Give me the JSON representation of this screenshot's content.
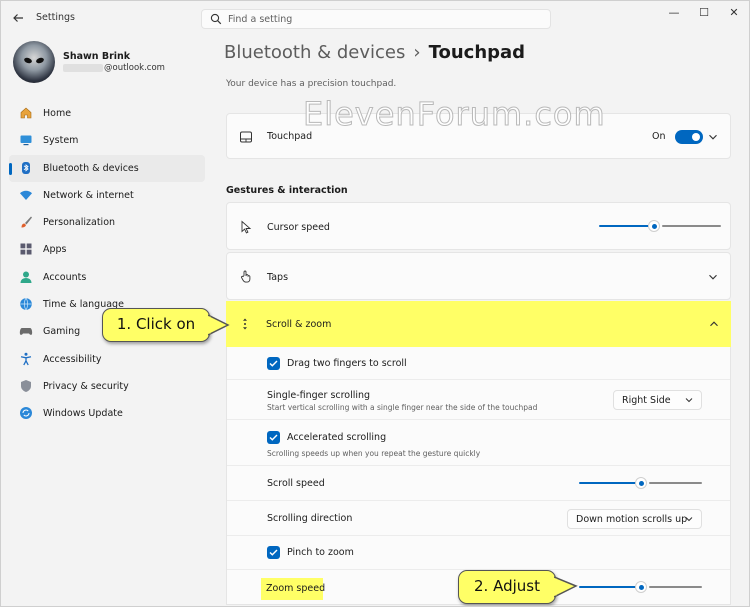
{
  "window": {
    "title": "Settings",
    "controls": {
      "minimize": "—",
      "maximize": "☐",
      "close": "✕"
    }
  },
  "search": {
    "placeholder": "Find a setting"
  },
  "profile": {
    "name": "Shawn Brink",
    "email_suffix": "@outlook.com"
  },
  "sidebar": {
    "items": [
      {
        "label": "Home",
        "icon": "home-icon"
      },
      {
        "label": "System",
        "icon": "monitor-icon"
      },
      {
        "label": "Bluetooth & devices",
        "icon": "bluetooth-icon",
        "active": true
      },
      {
        "label": "Network & internet",
        "icon": "wifi-icon"
      },
      {
        "label": "Personalization",
        "icon": "brush-icon"
      },
      {
        "label": "Apps",
        "icon": "apps-icon"
      },
      {
        "label": "Accounts",
        "icon": "person-icon"
      },
      {
        "label": "Time & language",
        "icon": "globe-clock-icon"
      },
      {
        "label": "Gaming",
        "icon": "gamepad-icon"
      },
      {
        "label": "Accessibility",
        "icon": "accessibility-icon"
      },
      {
        "label": "Privacy & security",
        "icon": "shield-icon"
      },
      {
        "label": "Windows Update",
        "icon": "update-icon"
      }
    ]
  },
  "main": {
    "breadcrumb_parent": "Bluetooth & devices",
    "breadcrumb_sep": "›",
    "breadcrumb_current": "Touchpad",
    "device_desc": "Your device has a precision touchpad.",
    "watermark": "ElevenForum.com",
    "touchpad": {
      "label": "Touchpad",
      "state": "On",
      "on": true
    },
    "section_title": "Gestures & interaction",
    "cursor_speed": {
      "label": "Cursor speed",
      "value": 0.45
    },
    "taps": {
      "label": "Taps"
    },
    "scroll_zoom": {
      "label": "Scroll & zoom",
      "drag_two_fingers": {
        "label": "Drag two fingers to scroll",
        "checked": true
      },
      "single_finger": {
        "label": "Single-finger scrolling",
        "desc": "Start vertical scrolling with a single finger near the side of the touchpad",
        "value": "Right Side"
      },
      "accelerated": {
        "label": "Accelerated scrolling",
        "desc": "Scrolling speeds up when you repeat the gesture quickly",
        "checked": true
      },
      "scroll_speed": {
        "label": "Scroll speed",
        "value": 0.5
      },
      "scroll_direction": {
        "label": "Scrolling direction",
        "value": "Down motion scrolls up"
      },
      "pinch_zoom": {
        "label": "Pinch to zoom",
        "checked": true
      },
      "zoom_speed": {
        "label": "Zoom speed",
        "value": 0.5
      }
    }
  },
  "callouts": {
    "step1": "1. Click on",
    "step2": "2. Adjust"
  },
  "colors": {
    "accent": "#0067c0",
    "highlight": "#ffff66"
  }
}
